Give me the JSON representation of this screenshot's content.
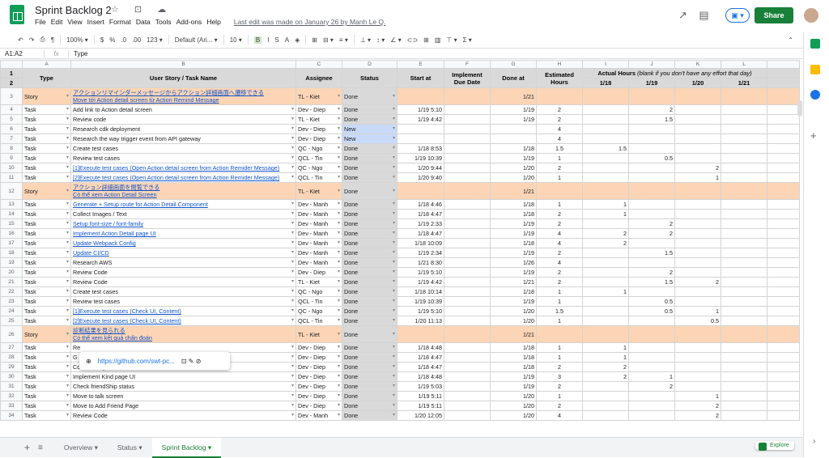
{
  "app": {
    "doc_title": "Sprint Backlog 2",
    "title_icons": "☆ ⊡ ☁",
    "menu": [
      "File",
      "Edit",
      "View",
      "Insert",
      "Format",
      "Data",
      "Tools",
      "Add-ons",
      "Help"
    ],
    "last_edit": "Last edit was made on January 26 by Manh Le Q.",
    "share_label": "Share",
    "trend_icon": "↗",
    "comment_icon": "▤",
    "present_label": "▣ ▾"
  },
  "toolbar": {
    "items": [
      "↶",
      "↷",
      "⎙",
      "¶",
      "100% ▾",
      "$",
      "%",
      ".0",
      ".00",
      "123 ▾",
      "Default (Ari... ▾",
      "10 ▾",
      "B",
      "I",
      "S",
      "A",
      "◈",
      "⊞",
      "⊟ ▾",
      "≡ ▾",
      "⊥ ▾",
      "↕ ▾",
      "∠ ▾",
      "⊂⊃",
      "⊞",
      "▥",
      "⊤ ▾",
      "Σ ▾"
    ],
    "collapse": "⌃"
  },
  "formula": {
    "ref": "A1:A2",
    "fx": "fx",
    "value": "Type"
  },
  "columns": [
    "A",
    "B",
    "C",
    "D",
    "E",
    "F",
    "G",
    "H",
    "I",
    "J",
    "K",
    "L"
  ],
  "header": {
    "type": "Type",
    "story": "User Story / Task Name",
    "assignee": "Assignee",
    "status": "Status",
    "start": "Start at",
    "impl_due": "Implement Due Date",
    "done": "Done at",
    "est": "Estimated Hours",
    "actual": "Actual Hours",
    "actual_note": "(blank if you don't have any effort that day)",
    "d1": "1/18",
    "d2": "1/19",
    "d3": "1/20",
    "d4": "1/21"
  },
  "rows": [
    {
      "n": "3",
      "type": "Story",
      "name": "アクションリマインダーメッセージからアクション詳細画面へ遷移できる",
      "name2": "Move tới Action detail screen từ Action Remind Message",
      "assignee": "TL - Kiet",
      "status": "Done",
      "start": "",
      "done": "1/21",
      "est": "",
      "a": [
        "",
        "",
        "",
        ""
      ],
      "story": true,
      "link": true
    },
    {
      "n": "4",
      "type": "Task",
      "name": "Add link to Action detail screen",
      "assignee": "Dev - Diep",
      "status": "Done",
      "start": "1/19 5:10",
      "done": "1/19",
      "est": "2",
      "a": [
        "",
        "2",
        "",
        ""
      ]
    },
    {
      "n": "5",
      "type": "Task",
      "name": "Review code",
      "assignee": "TL - Kiet",
      "status": "Done",
      "start": "1/19 4:42",
      "done": "1/19",
      "est": "2",
      "a": [
        "",
        "1.5",
        "",
        ""
      ]
    },
    {
      "n": "6",
      "type": "Task",
      "name": "Research cdk deployment",
      "assignee": "Dev - Diep",
      "status": "New",
      "start": "",
      "done": "",
      "est": "4",
      "a": [
        "",
        "",
        "",
        ""
      ]
    },
    {
      "n": "7",
      "type": "Task",
      "name": "Research the way trigger event from API gateway",
      "assignee": "Dev - Diep",
      "status": "New",
      "start": "",
      "done": "",
      "est": "4",
      "a": [
        "",
        "",
        "",
        ""
      ]
    },
    {
      "n": "8",
      "type": "Task",
      "name": "Create test cases",
      "assignee": "QC - Ngo",
      "status": "Done",
      "start": "1/18 8:53",
      "done": "1/18",
      "est": "1.5",
      "a": [
        "1.5",
        "",
        "",
        ""
      ]
    },
    {
      "n": "9",
      "type": "Task",
      "name": "Review test cases",
      "assignee": "QCL - Tin",
      "status": "Done",
      "start": "1/19 10:39",
      "done": "1/19",
      "est": "1",
      "a": [
        "",
        "0.5",
        "",
        ""
      ]
    },
    {
      "n": "10",
      "type": "Task",
      "name": "[1]Execute test cases (Open Action detail screen from Action Remider Message)",
      "assignee": "QC - Ngo",
      "status": "Done",
      "start": "1/20 9:44",
      "done": "1/20",
      "est": "2",
      "a": [
        "",
        "",
        "2",
        ""
      ],
      "link": true
    },
    {
      "n": "11",
      "type": "Task",
      "name": "[2]Execute test cases (Open Action detail screen from Action Remider Message)",
      "assignee": "QCL - Tin",
      "status": "Done",
      "start": "1/20 9:40",
      "done": "1/20",
      "est": "1",
      "a": [
        "",
        "",
        "1",
        ""
      ],
      "link": true
    },
    {
      "n": "12",
      "type": "Story",
      "name": "アクション詳細画面を閲覧できる",
      "name2": "Có thể xem Action Detail Screen",
      "assignee": "TL - Kiet",
      "status": "Done",
      "start": "",
      "done": "1/21",
      "est": "",
      "a": [
        "",
        "",
        "",
        ""
      ],
      "story": true,
      "link": true
    },
    {
      "n": "13",
      "type": "Task",
      "name": "Generate + Setup route for Action Detail Component",
      "assignee": "Dev - Manh",
      "status": "Done",
      "start": "1/18 4:46",
      "done": "1/18",
      "est": "1",
      "a": [
        "1",
        "",
        "",
        ""
      ],
      "link": true
    },
    {
      "n": "14",
      "type": "Task",
      "name": "Collect Images / Text",
      "assignee": "Dev - Manh",
      "status": "Done",
      "start": "1/18 4:47",
      "done": "1/18",
      "est": "2",
      "a": [
        "1",
        "",
        "",
        ""
      ]
    },
    {
      "n": "15",
      "type": "Task",
      "name": "Setup font-size / font-family",
      "assignee": "Dev - Manh",
      "status": "Done",
      "start": "1/19 2:33",
      "done": "1/19",
      "est": "2",
      "a": [
        "",
        "2",
        "",
        ""
      ],
      "link": true
    },
    {
      "n": "16",
      "type": "Task",
      "name": "Implement Action Detail page UI",
      "assignee": "Dev - Manh",
      "status": "Done",
      "start": "1/18 4:47",
      "done": "1/19",
      "est": "4",
      "a": [
        "2",
        "2",
        "",
        ""
      ],
      "link": true
    },
    {
      "n": "17",
      "type": "Task",
      "name": "Update Webpack Config",
      "assignee": "Dev - Manh",
      "status": "Done",
      "start": "1/18 10:09",
      "done": "1/18",
      "est": "4",
      "a": [
        "2",
        "",
        "",
        ""
      ],
      "link": true
    },
    {
      "n": "18",
      "type": "Task",
      "name": "Update CI/CD",
      "assignee": "Dev - Manh",
      "status": "Done",
      "start": "1/19 2:34",
      "done": "1/19",
      "est": "2",
      "a": [
        "",
        "1.5",
        "",
        ""
      ],
      "link": true
    },
    {
      "n": "19",
      "type": "Task",
      "name": "Research AWS",
      "assignee": "Dev - Manh",
      "status": "Done",
      "start": "1/21 8:30",
      "done": "1/26",
      "est": "4",
      "a": [
        "",
        "",
        "",
        ""
      ]
    },
    {
      "n": "20",
      "type": "Task",
      "name": "Review Code",
      "assignee": "Dev - Diep",
      "status": "Done",
      "start": "1/19 5:10",
      "done": "1/19",
      "est": "2",
      "a": [
        "",
        "2",
        "",
        ""
      ]
    },
    {
      "n": "21",
      "type": "Task",
      "name": "Review Code",
      "assignee": "TL - Kiet",
      "status": "Done",
      "start": "1/19 4:42",
      "done": "1/21",
      "est": "2",
      "a": [
        "",
        "1.5",
        "2",
        ""
      ]
    },
    {
      "n": "22",
      "type": "Task",
      "name": "Create test cases",
      "assignee": "QC - Ngo",
      "status": "Done",
      "start": "1/18 10:14",
      "done": "1/18",
      "est": "1",
      "a": [
        "1",
        "",
        "",
        ""
      ]
    },
    {
      "n": "23",
      "type": "Task",
      "name": "Review test cases",
      "assignee": "QCL - Tin",
      "status": "Done",
      "start": "1/19 10:39",
      "done": "1/19",
      "est": "1",
      "a": [
        "",
        "0.5",
        "",
        ""
      ]
    },
    {
      "n": "24",
      "type": "Task",
      "name": "[1]Execute test cases (Check UI, Content)",
      "assignee": "QC - Ngo",
      "status": "Done",
      "start": "1/19 5:10",
      "done": "1/20",
      "est": "1.5",
      "a": [
        "",
        "0.5",
        "1",
        ""
      ],
      "link": true
    },
    {
      "n": "25",
      "type": "Task",
      "name": "[2]Execute test cases (Check UI, Content)",
      "assignee": "QCL - Tin",
      "status": "Done",
      "start": "1/20 11:13",
      "done": "1/20",
      "est": "1",
      "a": [
        "",
        "",
        "0.5",
        ""
      ],
      "link": true
    },
    {
      "n": "26",
      "type": "Story",
      "name": "診断結果を見られる",
      "name2": "Có thể xem kết quả chẩn đoán",
      "assignee": "TL - Kiet",
      "status": "Done",
      "start": "",
      "done": "1/21",
      "est": "",
      "a": [
        "",
        "",
        "",
        ""
      ],
      "story": true,
      "link": true
    },
    {
      "n": "27",
      "type": "Task",
      "name": "Re",
      "assignee": "Dev - Diep",
      "status": "Done",
      "start": "1/18 4:48",
      "done": "1/18",
      "est": "1",
      "a": [
        "1",
        "",
        "",
        ""
      ]
    },
    {
      "n": "28",
      "type": "Task",
      "name": "G",
      "assignee": "Dev - Diep",
      "status": "Done",
      "start": "1/18 4:47",
      "done": "1/18",
      "est": "1",
      "a": [
        "1",
        "",
        "",
        ""
      ]
    },
    {
      "n": "29",
      "type": "Task",
      "name": "Collect Images / Text",
      "assignee": "Dev - Diep",
      "status": "Done",
      "start": "1/18 4:47",
      "done": "1/18",
      "est": "2",
      "a": [
        "2",
        "",
        "",
        ""
      ]
    },
    {
      "n": "30",
      "type": "Task",
      "name": "Implement Kind page UI",
      "assignee": "Dev - Diep",
      "status": "Done",
      "start": "1/18 4:48",
      "done": "1/19",
      "est": "3",
      "a": [
        "2",
        "1",
        "",
        ""
      ]
    },
    {
      "n": "31",
      "type": "Task",
      "name": "Check friendShip status",
      "assignee": "Dev - Diep",
      "status": "Done",
      "start": "1/19 5:03",
      "done": "1/19",
      "est": "2",
      "a": [
        "",
        "2",
        "",
        ""
      ]
    },
    {
      "n": "32",
      "type": "Task",
      "name": "Move to talk screen",
      "assignee": "Dev - Diep",
      "status": "Done",
      "start": "1/19 5:11",
      "done": "1/20",
      "est": "1",
      "a": [
        "",
        "",
        "1",
        ""
      ]
    },
    {
      "n": "33",
      "type": "Task",
      "name": "Move to Add Friend Page",
      "assignee": "Dev - Diep",
      "status": "Done",
      "start": "1/19 5:11",
      "done": "1/20",
      "est": "2",
      "a": [
        "",
        "",
        "2",
        ""
      ]
    },
    {
      "n": "34",
      "type": "Task",
      "name": "Review Code",
      "assignee": "Dev - Manh",
      "status": "Done",
      "start": "1/20 12:05",
      "done": "1/20",
      "est": "4",
      "a": [
        "",
        "",
        "2",
        ""
      ]
    }
  ],
  "popup": {
    "url": "https://github.com/swt-pc...",
    "icons": "⊡ ✎ ⊘"
  },
  "tabs": {
    "add": "+",
    "all": "≡",
    "items": [
      "Overview ▾",
      "Status ▾",
      "Sprint Backlog ▾"
    ],
    "explore": "Explore"
  },
  "colors": {
    "story_bg": "#fbd5b5",
    "done_bg": "#d9d9d9",
    "new_bg": "#c9daf8",
    "share_green": "#188038"
  }
}
